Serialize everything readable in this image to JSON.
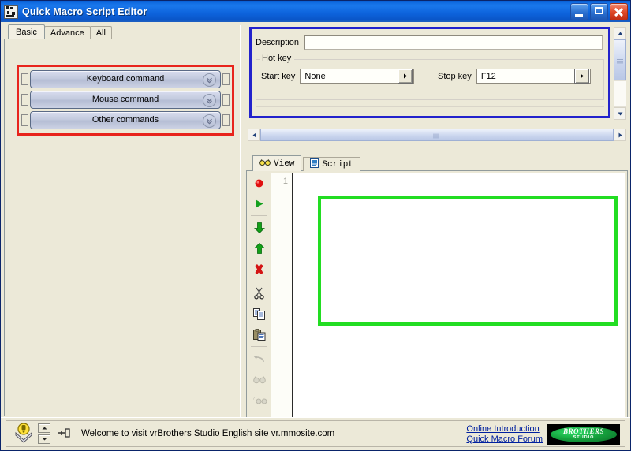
{
  "window": {
    "title": "Quick Macro Script Editor",
    "icon": "app-icon",
    "minimize_label": "Minimize",
    "maximize_label": "Restore",
    "close_label": "Close"
  },
  "left_panel": {
    "tabs": [
      {
        "label": "Basic",
        "active": true
      },
      {
        "label": "Advance",
        "active": false
      },
      {
        "label": "All",
        "active": false
      }
    ],
    "commands": [
      {
        "label": "Keyboard command",
        "icon": "chevron-down-circle-icon"
      },
      {
        "label": "Mouse command",
        "icon": "chevron-down-circle-icon"
      },
      {
        "label": "Other commands",
        "icon": "chevron-down-circle-icon"
      }
    ]
  },
  "properties": {
    "description_label": "Description",
    "description_value": "",
    "description_placeholder": "",
    "hotkey_group_label": "Hot key",
    "start_key_label": "Start key",
    "start_key_value": "None",
    "stop_key_label": "Stop key",
    "stop_key_value": "F12"
  },
  "editor": {
    "tabs": [
      {
        "label": "View",
        "icon": "binoculars-icon",
        "active": true
      },
      {
        "label": "Script",
        "icon": "document-icon",
        "active": false
      }
    ],
    "line_numbers": [
      "1"
    ],
    "content": "",
    "toolbar": [
      {
        "name": "record-button",
        "icon": "record-dot-icon",
        "enabled": true
      },
      {
        "name": "play-button",
        "icon": "play-triangle-icon",
        "enabled": true
      },
      {
        "name": "move-down-button",
        "icon": "arrow-down-icon",
        "enabled": true
      },
      {
        "name": "move-up-button",
        "icon": "arrow-up-icon",
        "enabled": true
      },
      {
        "name": "delete-button",
        "icon": "red-x-icon",
        "enabled": true
      },
      {
        "name": "cut-button",
        "icon": "scissors-icon",
        "enabled": true
      },
      {
        "name": "copy-button",
        "icon": "copy-icon",
        "enabled": true
      },
      {
        "name": "paste-button",
        "icon": "clipboard-paste-icon",
        "enabled": true
      },
      {
        "name": "undo-button",
        "icon": "undo-arrow-icon",
        "enabled": false
      },
      {
        "name": "find-button",
        "icon": "binoculars-icon",
        "enabled": false
      },
      {
        "name": "find-replace-button",
        "icon": "binoculars-question-icon",
        "enabled": false
      }
    ]
  },
  "status_bar": {
    "tip_icon": "lightbulb-icon",
    "spinner_up": "spinner-up-arrow",
    "spinner_down": "spinner-down-arrow",
    "pin_icon": "pushpin-icon",
    "message": "Welcome to visit vrBrothers Studio English site vr.mmosite.com",
    "links": [
      {
        "label": "Online Introduction"
      },
      {
        "label": "Quick Macro Forum"
      }
    ],
    "logo_primary": "BROTHERS",
    "logo_secondary": "STUDIO"
  },
  "annotations": [
    {
      "name": "red-highlight",
      "color": "#e8241c",
      "target": "command-list"
    },
    {
      "name": "blue-highlight",
      "color": "#2222cc",
      "target": "properties-panel"
    },
    {
      "name": "green-highlight",
      "color": "#22dd22",
      "target": "script-canvas"
    }
  ],
  "colors": {
    "titlebar": "#0f6ae0",
    "face": "#ece9d8",
    "accent_red": "#e8241c",
    "accent_blue": "#2222cc",
    "accent_green": "#22dd22",
    "link": "#00209f"
  }
}
